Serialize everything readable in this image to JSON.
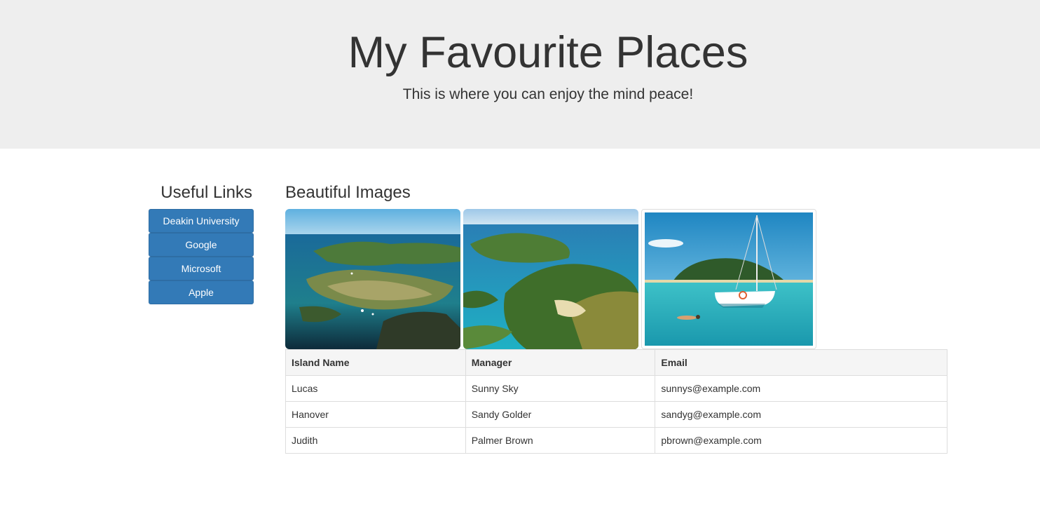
{
  "header": {
    "title": "My Favourite Places",
    "subtitle": "This is where you can enjoy the mind peace!"
  },
  "sidebar": {
    "heading": "Useful Links",
    "links": [
      {
        "label": "Deakin University"
      },
      {
        "label": "Google"
      },
      {
        "label": "Microsoft"
      },
      {
        "label": "Apple"
      }
    ]
  },
  "main": {
    "heading": "Beautiful Images",
    "images": [
      {
        "name": "island-aerial-1"
      },
      {
        "name": "island-aerial-2"
      },
      {
        "name": "sailboat-lagoon"
      }
    ],
    "table": {
      "headers": [
        "Island Name",
        "Manager",
        "Email"
      ],
      "rows": [
        [
          "Lucas",
          "Sunny Sky",
          "sunnys@example.com"
        ],
        [
          "Hanover",
          "Sandy Golder",
          "sandyg@example.com"
        ],
        [
          "Judith",
          "Palmer Brown",
          "pbrown@example.com"
        ]
      ]
    }
  },
  "colors": {
    "jumbotron_bg": "#eeeeee",
    "button_primary": "#337ab7",
    "table_header_bg": "#f5f5f5"
  }
}
